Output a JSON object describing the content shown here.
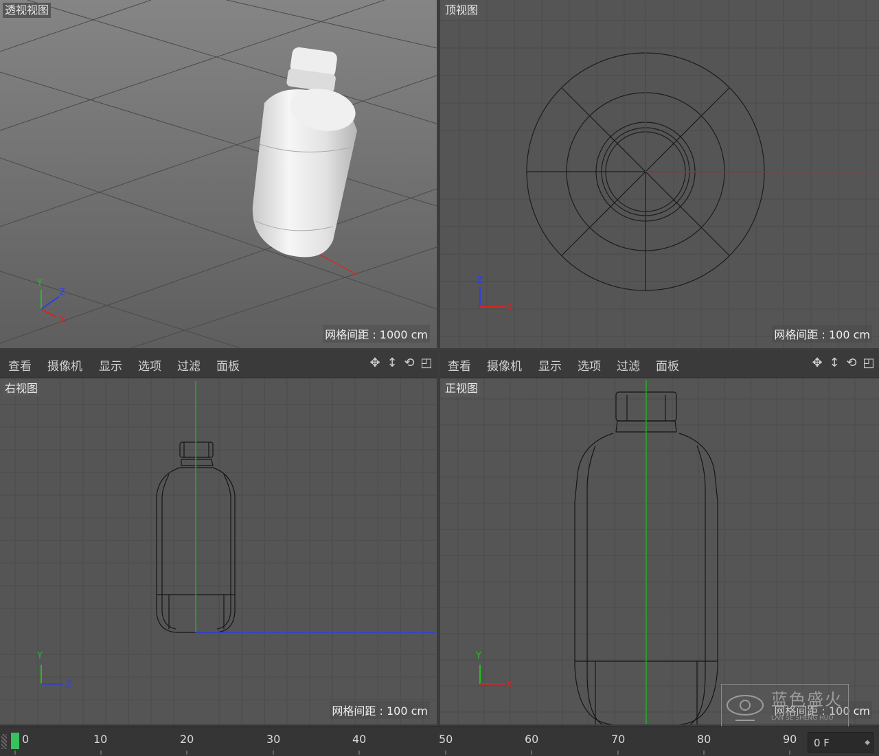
{
  "viewports": {
    "perspective": {
      "title": "透视视图",
      "grid_spacing": "网格间距 : 1000 cm"
    },
    "top": {
      "title": "顶视图",
      "grid_spacing": "网格间距 : 100 cm"
    },
    "right": {
      "title": "右视图",
      "grid_spacing": "网格间距 : 100 cm"
    },
    "front": {
      "title": "正视图",
      "grid_spacing": "网格间距 : 100 cm"
    }
  },
  "menu": {
    "items": [
      "查看",
      "摄像机",
      "显示",
      "选项",
      "过滤",
      "面板"
    ],
    "tool_icons": [
      "move-view-icon",
      "zoom-view-icon",
      "rotate-view-icon",
      "maximize-view-icon"
    ]
  },
  "axes": {
    "perspective": [
      "Y",
      "Z",
      "X"
    ],
    "top": [
      "Z",
      "X"
    ],
    "right": [
      "Y",
      "Z"
    ],
    "front": [
      "Y",
      "X"
    ]
  },
  "timeline": {
    "ticks": [
      "0",
      "10",
      "20",
      "30",
      "40",
      "50",
      "60",
      "70",
      "80",
      "90"
    ],
    "current_frame": "0 F",
    "playhead_frame": 0
  },
  "watermark": {
    "name": "蓝色盛火",
    "sub": "LAN SE SHENG HUO"
  },
  "colors": {
    "x_axis": "#e02020",
    "y_axis": "#20c020",
    "z_axis": "#3040e0",
    "viewport_bg": "#555555",
    "playhead": "#36c25c"
  }
}
